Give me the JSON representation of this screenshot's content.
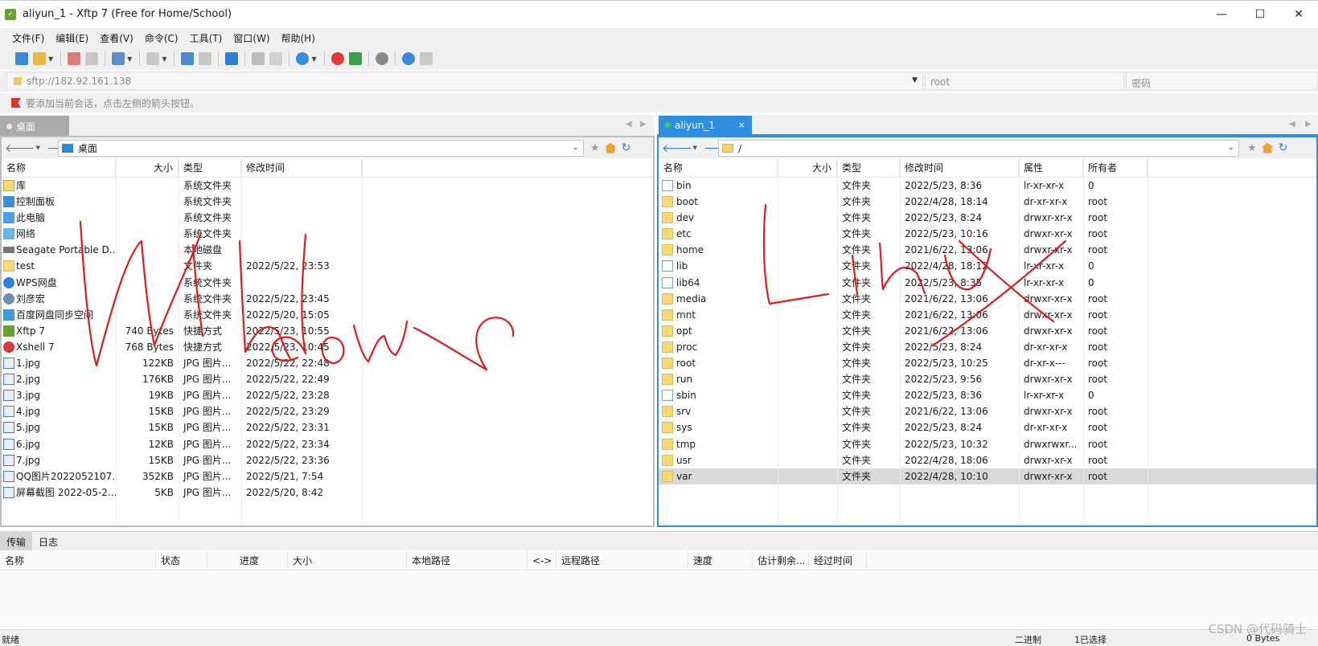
{
  "window": {
    "title": "aliyun_1 - Xftp 7 (Free for Home/School)",
    "minimize_glyph": "—",
    "maximize_glyph": "☐",
    "close_glyph": "✕"
  },
  "menu": [
    "文件(F)",
    "编辑(E)",
    "查看(V)",
    "命令(C)",
    "工具(T)",
    "窗口(W)",
    "帮助(H)"
  ],
  "address": {
    "url": "sftp://182.92.161.138",
    "username_placeholder": "root",
    "password_placeholder": "密码"
  },
  "hint": "要添加当前会话，点击左侧的箭头按钮。",
  "local": {
    "tab_label": "桌面",
    "path": "桌面",
    "columns": [
      "名称",
      "大小",
      "类型",
      "修改时间"
    ],
    "rows": [
      {
        "name": "库",
        "size": "",
        "type": "系统文件夹",
        "modified": "",
        "icon": "library-icon"
      },
      {
        "name": "控制面板",
        "size": "",
        "type": "系统文件夹",
        "modified": "",
        "icon": "control-panel-icon"
      },
      {
        "name": "此电脑",
        "size": "",
        "type": "系统文件夹",
        "modified": "",
        "icon": "computer-icon"
      },
      {
        "name": "网络",
        "size": "",
        "type": "系统文件夹",
        "modified": "",
        "icon": "network-icon"
      },
      {
        "name": "Seagate Portable D...",
        "size": "",
        "type": "本地磁盘",
        "modified": "",
        "icon": "drive-icon"
      },
      {
        "name": "test",
        "size": "",
        "type": "文件夹",
        "modified": "2022/5/22, 23:53",
        "icon": "folder-icon"
      },
      {
        "name": "WPS网盘",
        "size": "",
        "type": "系统文件夹",
        "modified": "",
        "icon": "wps-cloud-icon"
      },
      {
        "name": "刘彦宏",
        "size": "",
        "type": "系统文件夹",
        "modified": "2022/5/22, 23:45",
        "icon": "user-folder-icon"
      },
      {
        "name": "百度网盘同步空间",
        "size": "",
        "type": "系统文件夹",
        "modified": "2022/5/20, 15:05",
        "icon": "baidu-sync-icon"
      },
      {
        "name": "Xftp 7",
        "size": "740 Bytes",
        "type": "快捷方式",
        "modified": "2022/5/23, 10:55",
        "icon": "xftp-shortcut-icon"
      },
      {
        "name": "Xshell 7",
        "size": "768 Bytes",
        "type": "快捷方式",
        "modified": "2022/5/23, 10:45",
        "icon": "xshell-shortcut-icon"
      },
      {
        "name": "1.jpg",
        "size": "122KB",
        "type": "JPG 图片...",
        "modified": "2022/5/22, 22:48",
        "icon": "jpg-file-icon"
      },
      {
        "name": "2.jpg",
        "size": "176KB",
        "type": "JPG 图片...",
        "modified": "2022/5/22, 22:49",
        "icon": "jpg-file-icon"
      },
      {
        "name": "3.jpg",
        "size": "19KB",
        "type": "JPG 图片...",
        "modified": "2022/5/22, 23:28",
        "icon": "jpg-file-icon"
      },
      {
        "name": "4.jpg",
        "size": "15KB",
        "type": "JPG 图片...",
        "modified": "2022/5/22, 23:29",
        "icon": "jpg-file-icon"
      },
      {
        "name": "5.jpg",
        "size": "15KB",
        "type": "JPG 图片...",
        "modified": "2022/5/22, 23:31",
        "icon": "jpg-file-icon"
      },
      {
        "name": "6.jpg",
        "size": "12KB",
        "type": "JPG 图片...",
        "modified": "2022/5/22, 23:34",
        "icon": "jpg-file-icon"
      },
      {
        "name": "7.jpg",
        "size": "15KB",
        "type": "JPG 图片...",
        "modified": "2022/5/22, 23:36",
        "icon": "jpg-file-icon"
      },
      {
        "name": "QQ图片2022052107...",
        "size": "352KB",
        "type": "JPG 图片...",
        "modified": "2022/5/21, 7:54",
        "icon": "jpg-file-icon"
      },
      {
        "name": "屏幕截图 2022-05-2...",
        "size": "5KB",
        "type": "JPG 图片...",
        "modified": "2022/5/20, 8:42",
        "icon": "jpg-file-icon"
      }
    ]
  },
  "remote": {
    "tab_label": "aliyun_1",
    "tab_close": "×",
    "path": "/",
    "columns": [
      "名称",
      "大小",
      "类型",
      "修改时间",
      "属性",
      "所有者"
    ],
    "rows": [
      {
        "name": "bin",
        "type": "文件夹",
        "modified": "2022/5/23, 8:36",
        "attr": "lr-xr-xr-x",
        "owner": "0",
        "link": true
      },
      {
        "name": "boot",
        "type": "文件夹",
        "modified": "2022/4/28, 18:14",
        "attr": "dr-xr-xr-x",
        "owner": "root",
        "link": false
      },
      {
        "name": "dev",
        "type": "文件夹",
        "modified": "2022/5/23, 8:24",
        "attr": "drwxr-xr-x",
        "owner": "root",
        "link": false
      },
      {
        "name": "etc",
        "type": "文件夹",
        "modified": "2022/5/23, 10:16",
        "attr": "drwxr-xr-x",
        "owner": "root",
        "link": false
      },
      {
        "name": "home",
        "type": "文件夹",
        "modified": "2021/6/22, 13:06",
        "attr": "drwxr-xr-x",
        "owner": "root",
        "link": false
      },
      {
        "name": "lib",
        "type": "文件夹",
        "modified": "2022/4/28, 18:12",
        "attr": "lr-xr-xr-x",
        "owner": "0",
        "link": true
      },
      {
        "name": "lib64",
        "type": "文件夹",
        "modified": "2022/5/23, 8:35",
        "attr": "lr-xr-xr-x",
        "owner": "0",
        "link": true
      },
      {
        "name": "media",
        "type": "文件夹",
        "modified": "2021/6/22, 13:06",
        "attr": "drwxr-xr-x",
        "owner": "root",
        "link": false
      },
      {
        "name": "mnt",
        "type": "文件夹",
        "modified": "2021/6/22, 13:06",
        "attr": "drwxr-xr-x",
        "owner": "root",
        "link": false
      },
      {
        "name": "opt",
        "type": "文件夹",
        "modified": "2021/6/22, 13:06",
        "attr": "drwxr-xr-x",
        "owner": "root",
        "link": false
      },
      {
        "name": "proc",
        "type": "文件夹",
        "modified": "2022/5/23, 8:24",
        "attr": "dr-xr-xr-x",
        "owner": "root",
        "link": false
      },
      {
        "name": "root",
        "type": "文件夹",
        "modified": "2022/5/23, 10:25",
        "attr": "dr-xr-x---",
        "owner": "root",
        "link": false
      },
      {
        "name": "run",
        "type": "文件夹",
        "modified": "2022/5/23, 9:56",
        "attr": "drwxr-xr-x",
        "owner": "root",
        "link": false
      },
      {
        "name": "sbin",
        "type": "文件夹",
        "modified": "2022/5/23, 8:36",
        "attr": "lr-xr-xr-x",
        "owner": "0",
        "link": true
      },
      {
        "name": "srv",
        "type": "文件夹",
        "modified": "2021/6/22, 13:06",
        "attr": "drwxr-xr-x",
        "owner": "root",
        "link": false
      },
      {
        "name": "sys",
        "type": "文件夹",
        "modified": "2022/5/23, 8:24",
        "attr": "dr-xr-xr-x",
        "owner": "root",
        "link": false
      },
      {
        "name": "tmp",
        "type": "文件夹",
        "modified": "2022/5/23, 10:32",
        "attr": "drwxrwxr...",
        "owner": "root",
        "link": false
      },
      {
        "name": "usr",
        "type": "文件夹",
        "modified": "2022/4/28, 18:06",
        "attr": "drwxr-xr-x",
        "owner": "root",
        "link": false
      },
      {
        "name": "var",
        "type": "文件夹",
        "modified": "2022/4/28, 10:10",
        "attr": "drwxr-xr-x",
        "owner": "root",
        "link": false,
        "selected": true
      }
    ]
  },
  "transfer": {
    "tabs": [
      "传输",
      "日志"
    ],
    "columns": [
      "名称",
      "状态",
      "进度",
      "大小",
      "本地路径",
      "<->",
      "远程路径",
      "速度",
      "估计剩余...",
      "经过时间"
    ]
  },
  "status": {
    "left": "就绪",
    "mode": "二进制",
    "selection": "1已选择",
    "size": "0 Bytes"
  },
  "watermark": "CSDN @代码骑士",
  "colors": {
    "accent": "#2f8fe0",
    "annotation": "#e01b1b"
  }
}
